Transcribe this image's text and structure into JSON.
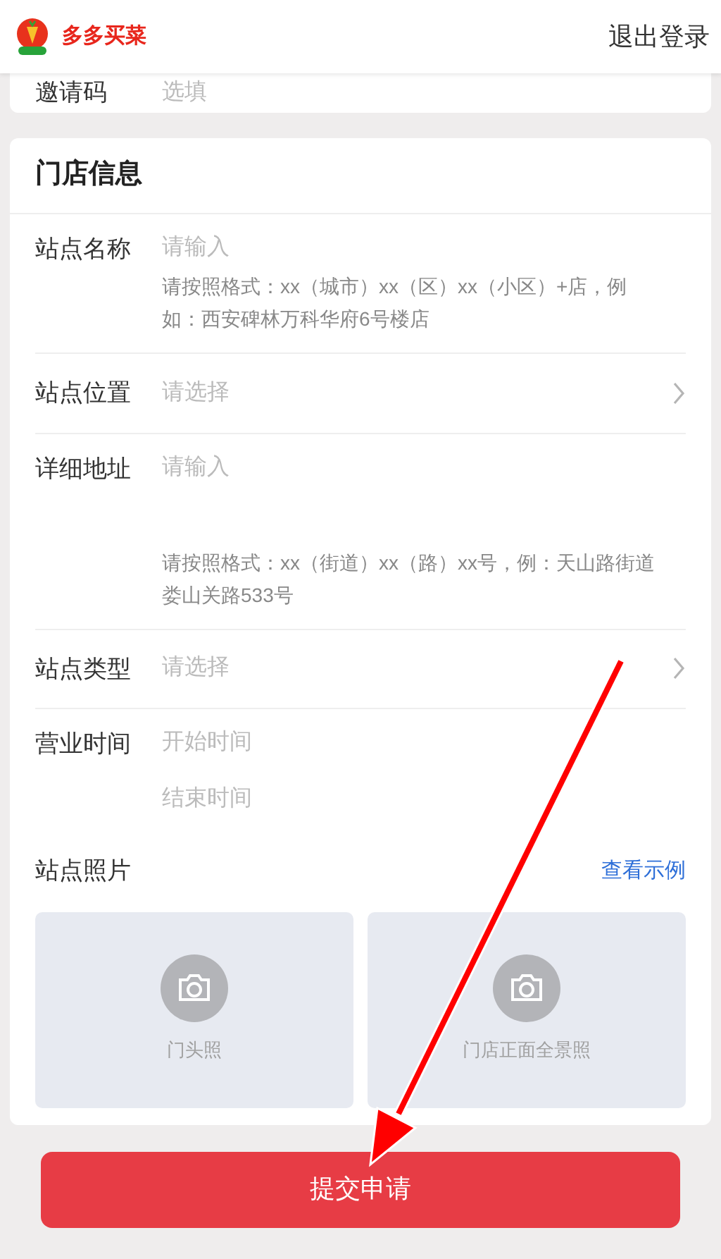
{
  "header": {
    "brand": "多多买菜",
    "logout": "退出登录"
  },
  "invite": {
    "label": "邀请码",
    "placeholder": "选填"
  },
  "store_info": {
    "title": "门店信息",
    "fields": [
      {
        "kind": "input",
        "label": "站点名称",
        "placeholder": "请输入",
        "hint": "请按照格式：xx（城市）xx（区）xx（小区）+店，例如：西安碑林万科华府6号楼店"
      },
      {
        "kind": "select",
        "label": "站点位置",
        "placeholder": "请选择"
      },
      {
        "kind": "textarea",
        "label": "详细地址",
        "placeholder": "请输入",
        "hint": "请按照格式：xx（街道）xx（路）xx号，例：天山路街道娄山关路533号"
      },
      {
        "kind": "select",
        "label": "站点类型",
        "placeholder": "请选择"
      },
      {
        "kind": "time_range",
        "label": "营业时间",
        "placeholders": [
          "开始时间",
          "结束时间"
        ]
      }
    ],
    "photos": {
      "label": "站点照片",
      "example_link": "查看示例",
      "slots": [
        {
          "caption": "门头照"
        },
        {
          "caption": "门店正面全景照"
        }
      ]
    }
  },
  "submit": "提交申请"
}
